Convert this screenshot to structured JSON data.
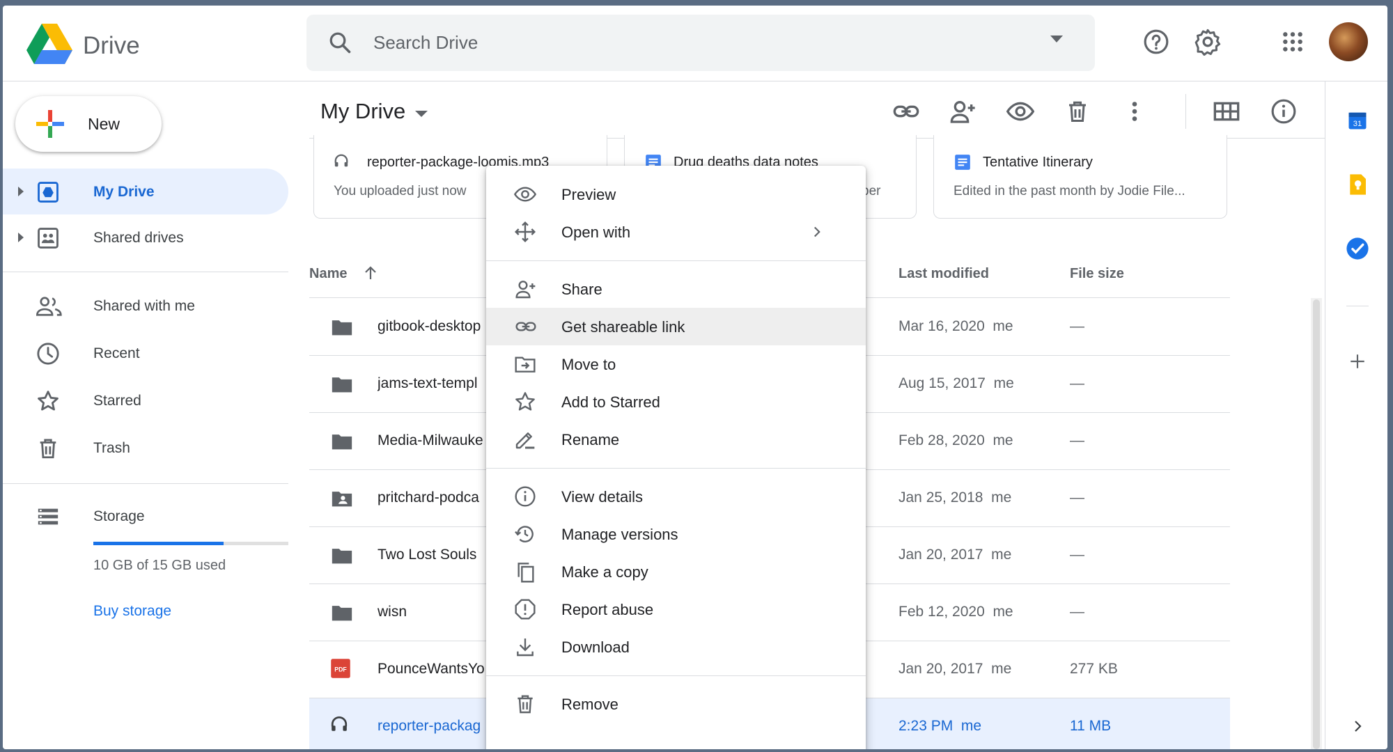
{
  "app": {
    "brand": "Drive"
  },
  "search": {
    "placeholder": "Search Drive"
  },
  "header_icons": [
    "help-icon",
    "settings-icon",
    "apps-icon",
    "account-avatar"
  ],
  "sidebar": {
    "new_label": "New",
    "items": [
      {
        "label": "My Drive",
        "icon": "my-drive-icon",
        "active": true
      },
      {
        "label": "Shared drives",
        "icon": "shared-drives-icon"
      },
      {
        "label": "Shared with me",
        "icon": "people-icon"
      },
      {
        "label": "Recent",
        "icon": "clock-icon"
      },
      {
        "label": "Starred",
        "icon": "star-icon"
      },
      {
        "label": "Trash",
        "icon": "trash-icon"
      },
      {
        "label": "Storage",
        "icon": "storage-icon"
      }
    ],
    "storage_text": "10 GB of 15 GB used",
    "storage_fraction": 0.667,
    "buy_storage": "Buy storage"
  },
  "toolbar": {
    "title": "My Drive",
    "icons": [
      "link-icon",
      "share-person-icon",
      "preview-eye-icon",
      "trash-icon",
      "more-vert-icon",
      "grid-view-icon",
      "info-icon"
    ]
  },
  "quick_access": [
    {
      "title": "reporter-package-loomis.mp3",
      "subtitle": "You uploaded just now",
      "icon": "audio-icon"
    },
    {
      "title": "Drug deaths data notes",
      "subtitle": "ber",
      "icon": "doc-icon"
    },
    {
      "title": "Tentative Itinerary",
      "subtitle": "Edited in the past month by Jodie File...",
      "icon": "doc-icon"
    }
  ],
  "table": {
    "columns": {
      "name": "Name",
      "modified": "Last modified",
      "size": "File size"
    },
    "rows": [
      {
        "name": "gitbook-desktop",
        "modified": "Mar 16, 2020",
        "owner": "me",
        "size": "—",
        "type": "folder"
      },
      {
        "name": "jams-text-templ",
        "modified": "Aug 15, 2017",
        "owner": "me",
        "size": "—",
        "type": "folder"
      },
      {
        "name": "Media-Milwauke",
        "modified": "Feb 28, 2020",
        "owner": "me",
        "size": "—",
        "type": "folder"
      },
      {
        "name": "pritchard-podca",
        "modified": "Jan 25, 2018",
        "owner": "me",
        "size": "—",
        "type": "shared-folder"
      },
      {
        "name": "Two Lost Souls",
        "modified": "Jan 20, 2017",
        "owner": "me",
        "size": "—",
        "type": "folder"
      },
      {
        "name": "wisn",
        "modified": "Feb 12, 2020",
        "owner": "me",
        "size": "—",
        "type": "folder"
      },
      {
        "name": "PounceWantsYo",
        "modified": "Jan 20, 2017",
        "owner": "me",
        "size": "277 KB",
        "type": "pdf"
      },
      {
        "name": "reporter-packag",
        "modified": "2:23 PM",
        "owner": "me",
        "size": "11 MB",
        "type": "audio",
        "selected": true
      }
    ]
  },
  "context_menu": {
    "items": [
      {
        "label": "Preview",
        "icon": "eye-icon"
      },
      {
        "label": "Open with",
        "icon": "move-arrows-icon",
        "submenu": true
      },
      {
        "label": "Share",
        "icon": "add-person-icon"
      },
      {
        "label": "Get shareable link",
        "icon": "link-icon",
        "highlighted": true
      },
      {
        "label": "Move to",
        "icon": "move-folder-icon"
      },
      {
        "label": "Add to Starred",
        "icon": "star-icon"
      },
      {
        "label": "Rename",
        "icon": "pencil-icon"
      },
      {
        "label": "View details",
        "icon": "info-icon"
      },
      {
        "label": "Manage versions",
        "icon": "history-icon"
      },
      {
        "label": "Make a copy",
        "icon": "copy-icon"
      },
      {
        "label": "Report abuse",
        "icon": "report-icon"
      },
      {
        "label": "Download",
        "icon": "download-icon"
      },
      {
        "label": "Remove",
        "icon": "trash-icon"
      }
    ]
  },
  "right_rail": [
    "calendar-icon",
    "keep-icon",
    "tasks-icon",
    "add-icon",
    "expand-icon"
  ],
  "right_rail_calendar_day": "31",
  "colors": {
    "accent": "#1a73e8",
    "active_bg": "#e8f0fe",
    "pdf_red": "#db4437",
    "keep_yellow": "#fbbc04"
  }
}
